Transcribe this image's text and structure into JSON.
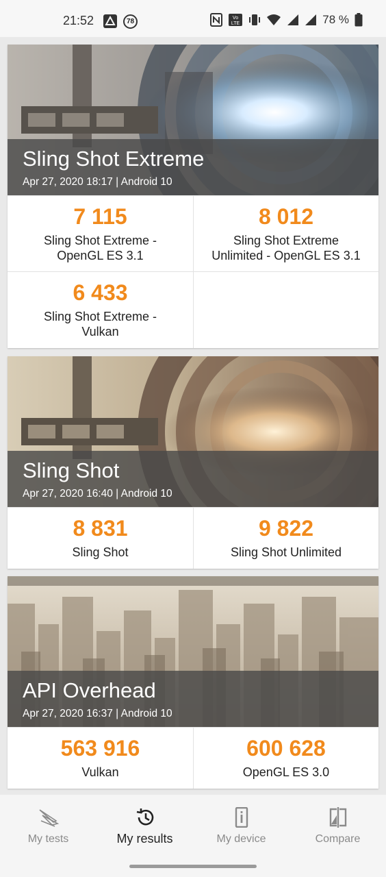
{
  "status_bar": {
    "time": "21:52",
    "notification_badge": "78",
    "battery": "78 %",
    "icons": [
      "nfc-icon",
      "volte-icon",
      "vibrate-icon",
      "wifi-icon",
      "signal-icon",
      "signal-icon",
      "battery-icon"
    ]
  },
  "results": [
    {
      "title": "Sling Shot Extreme",
      "meta": "Apr 27, 2020 18:17 | Android 10",
      "scores": [
        {
          "value": "7 115",
          "label_line1": "Sling Shot Extreme -",
          "label_line2": "OpenGL ES 3.1"
        },
        {
          "value": "8 012",
          "label_line1": "Sling Shot Extreme",
          "label_line2": "Unlimited - OpenGL ES 3.1"
        },
        {
          "value": "6 433",
          "label_line1": "Sling Shot Extreme -",
          "label_line2": "Vulkan"
        }
      ]
    },
    {
      "title": "Sling Shot",
      "meta": "Apr 27, 2020 16:40 | Android 10",
      "scores": [
        {
          "value": "8 831",
          "label_line1": "Sling Shot"
        },
        {
          "value": "9 822",
          "label_line1": "Sling Shot Unlimited"
        }
      ]
    },
    {
      "title": "API Overhead",
      "meta": "Apr 27, 2020 16:37 | Android 10",
      "scores": [
        {
          "value": "563 916",
          "label_line1": "Vulkan"
        },
        {
          "value": "600 628",
          "label_line1": "OpenGL ES 3.0"
        }
      ]
    }
  ],
  "nav": {
    "items": [
      {
        "label": "My tests",
        "icon": "benchmark-logo-icon"
      },
      {
        "label": "My results",
        "icon": "history-icon",
        "active": true
      },
      {
        "label": "My device",
        "icon": "device-info-icon"
      },
      {
        "label": "Compare",
        "icon": "compare-icon"
      }
    ]
  },
  "colors": {
    "score": "#f18a1c",
    "caption_band": "#484848"
  }
}
